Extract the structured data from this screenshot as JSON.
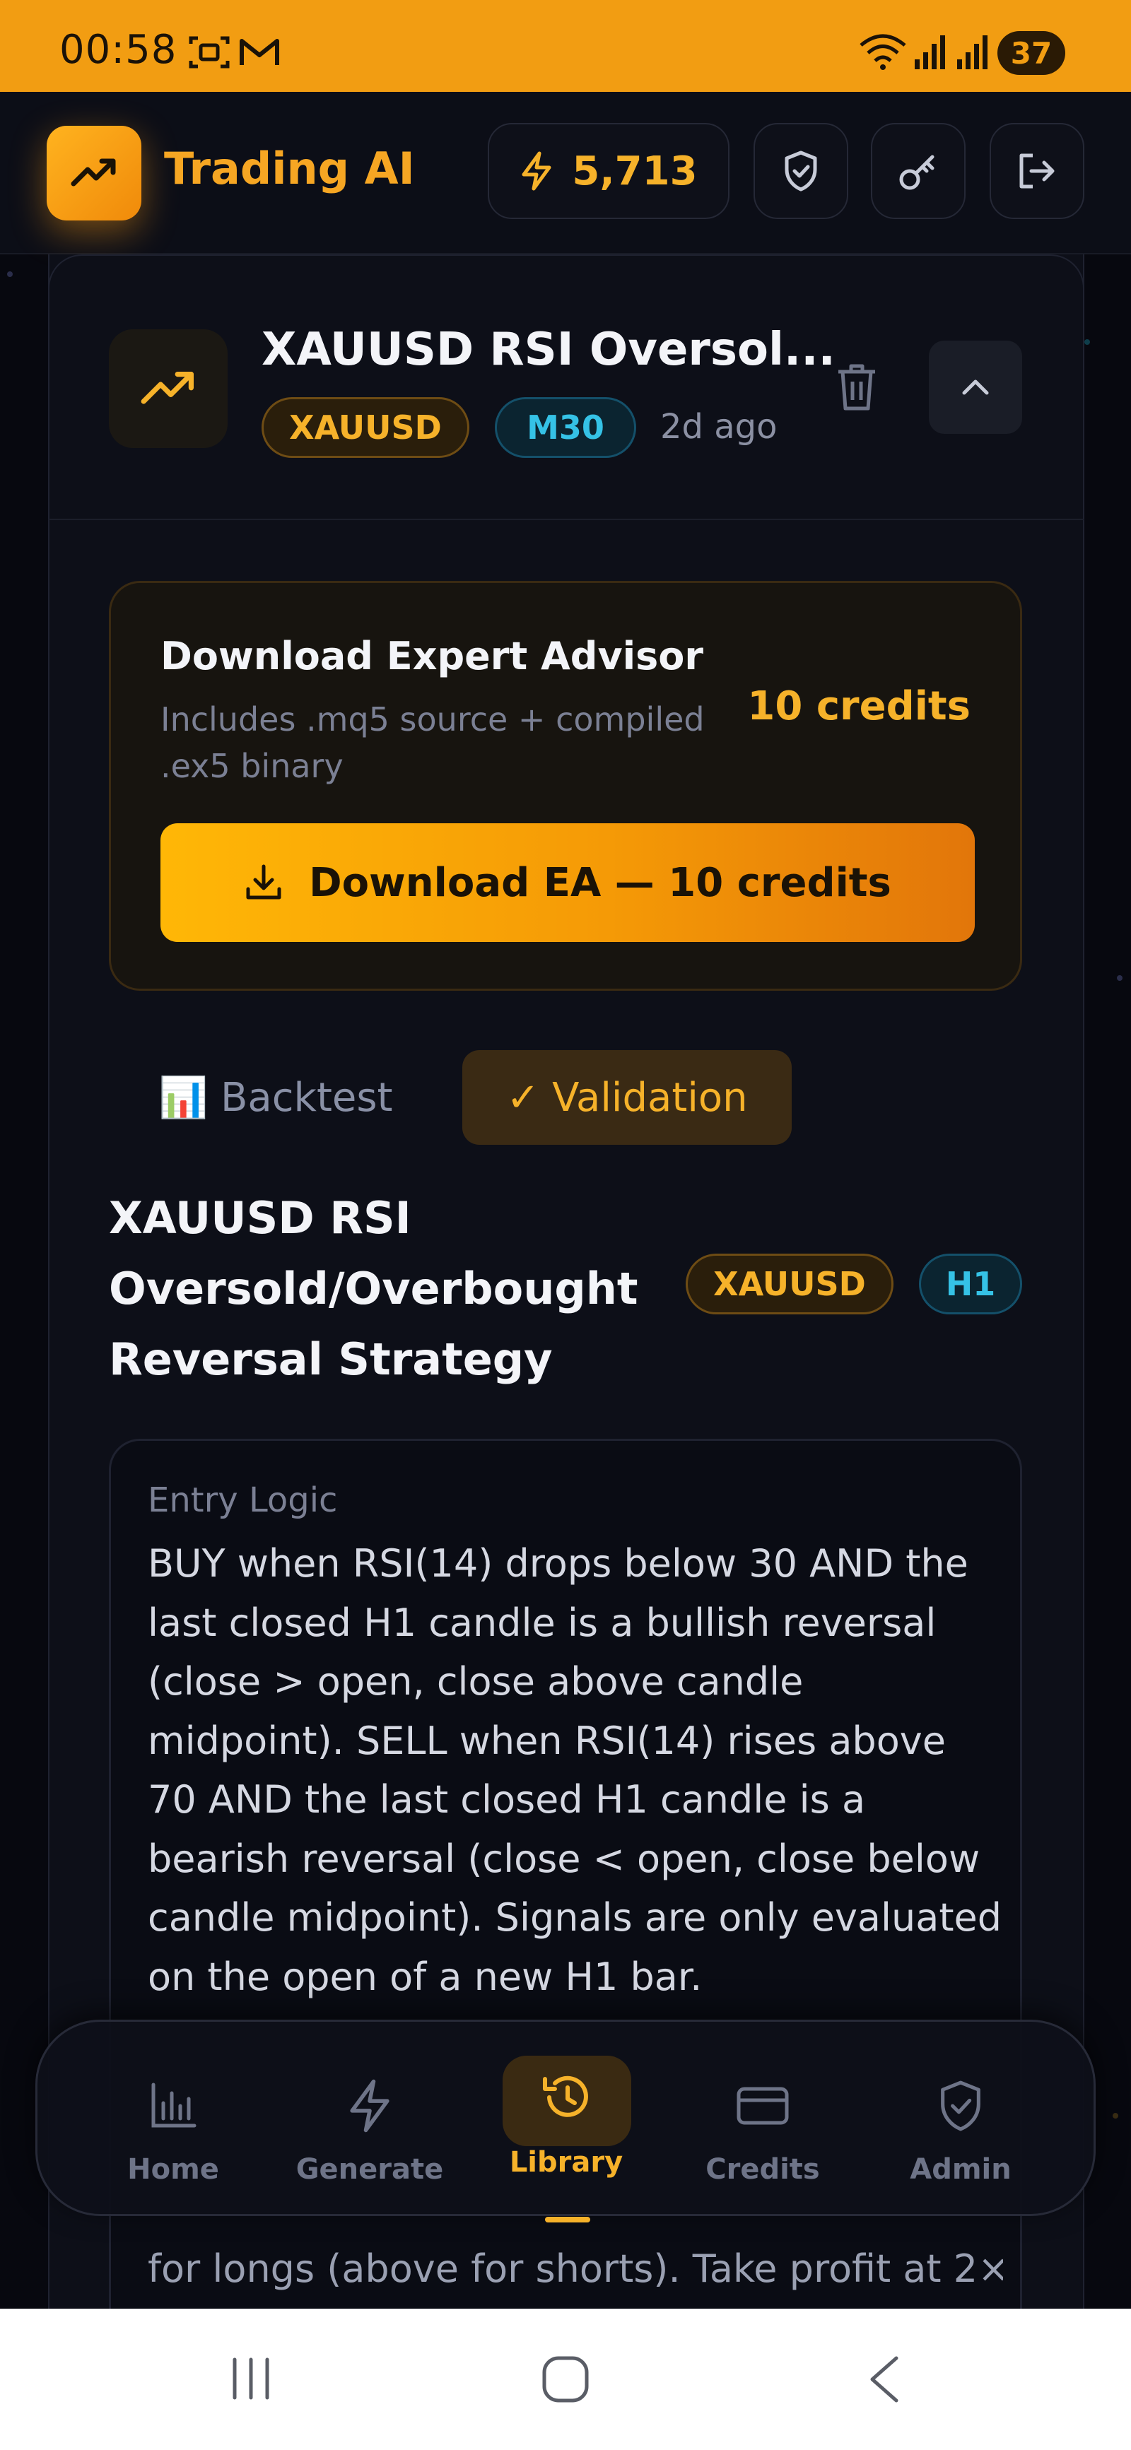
{
  "status_bar": {
    "time": "00:58",
    "battery": "37"
  },
  "header": {
    "app_title": "Trading AI",
    "credits_balance": "5,713"
  },
  "strategy": {
    "title": "XAUUSD RSI Oversol...",
    "symbol": "XAUUSD",
    "timeframe": "M30",
    "age": "2d ago"
  },
  "download": {
    "title": "Download Expert Advisor",
    "subtitle": "Includes .mq5 source + compiled .ex5 binary",
    "cost": "10 credits",
    "button_label": "Download EA — 10 credits"
  },
  "tabs": [
    {
      "label": "📊 Backtest",
      "active": false
    },
    {
      "label": "✓ Validation",
      "active": true
    }
  ],
  "validation": {
    "title": "XAUUSD RSI Oversold/Overbought Reversal Strategy",
    "symbol": "XAUUSD",
    "timeframe": "H1",
    "entry_label": "Entry Logic",
    "entry_text": "BUY when RSI(14) drops below 30 AND the last closed H1 candle is a bullish reversal (close > open, close above candle midpoint). SELL when RSI(14) rises above 70 AND the last closed H1 candle is a bearish reversal (close < open, close below candle midpoint). Signals are only evaluated on the open of a new H1 bar.",
    "exit_text_partial": "for longs (above for shorts). Take profit at 2×"
  },
  "nav": [
    {
      "label": "Home",
      "active": false
    },
    {
      "label": "Generate",
      "active": false
    },
    {
      "label": "Library",
      "active": true
    },
    {
      "label": "Credits",
      "active": false
    },
    {
      "label": "Admin",
      "active": false
    }
  ],
  "colors": {
    "accent": "#f6b22a",
    "status_bar": "#f29d12",
    "background": "#07080f",
    "cyan_tag": "#35c2e6"
  }
}
